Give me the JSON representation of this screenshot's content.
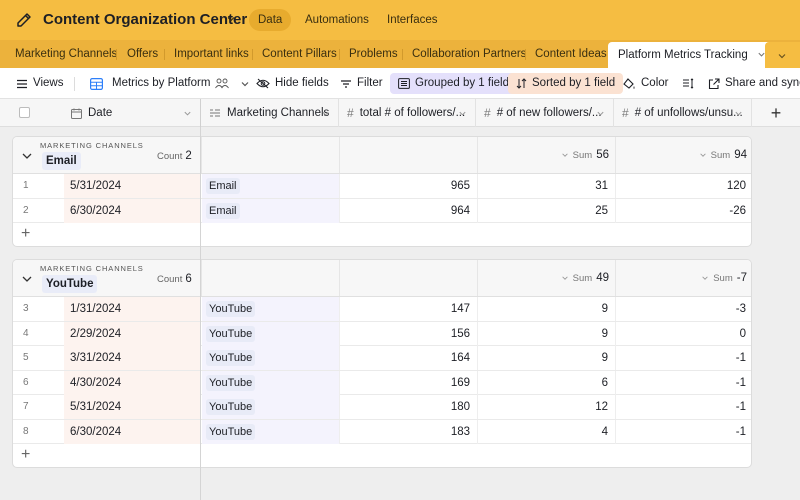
{
  "app": {
    "title": "Content Organization Center",
    "nav": [
      {
        "label": "Data",
        "active": true
      },
      {
        "label": "Automations",
        "active": false
      },
      {
        "label": "Interfaces",
        "active": false
      }
    ],
    "brand_color": "#f5bd42"
  },
  "tabs": [
    {
      "label": "Marketing Channels"
    },
    {
      "label": "Offers"
    },
    {
      "label": "Important links"
    },
    {
      "label": "Content Pillars"
    },
    {
      "label": "Problems"
    },
    {
      "label": "Collaboration Partners"
    },
    {
      "label": "Content Ideas"
    },
    {
      "label": "Platform Metrics Tracking",
      "active": true
    }
  ],
  "toolbar": {
    "views": "Views",
    "view_name": "Metrics by Platform",
    "hide_fields": "Hide fields",
    "filter": "Filter",
    "grouped": "Grouped by 1 field",
    "sorted": "Sorted by 1 field",
    "color": "Color",
    "share": "Share and sync"
  },
  "columns": [
    {
      "label": "Date",
      "icon": "calendar-icon"
    },
    {
      "label": "Marketing Channels",
      "icon": "link-field-icon"
    },
    {
      "label": "total # of followers/...",
      "icon": "number-icon"
    },
    {
      "label": "# of new followers/...",
      "icon": "number-icon"
    },
    {
      "label": "# of unfollows/unsu...",
      "icon": "number-icon"
    }
  ],
  "groups": [
    {
      "label": "MARKETING CHANNELS",
      "name": "Email",
      "count_label": "Count",
      "count": "2",
      "sum_label": "Sum",
      "sum_new": "56",
      "sum_unf": "94",
      "rows": [
        {
          "num": "1",
          "date": "5/31/2024",
          "channel": "Email",
          "total": "965",
          "new": "31",
          "unf": "120"
        },
        {
          "num": "2",
          "date": "6/30/2024",
          "channel": "Email",
          "total": "964",
          "new": "25",
          "unf": "-26"
        }
      ]
    },
    {
      "label": "MARKETING CHANNELS",
      "name": "YouTube",
      "count_label": "Count",
      "count": "6",
      "sum_label": "Sum",
      "sum_new": "49",
      "sum_unf": "-7",
      "rows": [
        {
          "num": "3",
          "date": "1/31/2024",
          "channel": "YouTube",
          "total": "147",
          "new": "9",
          "unf": "-3"
        },
        {
          "num": "4",
          "date": "2/29/2024",
          "channel": "YouTube",
          "total": "156",
          "new": "9",
          "unf": "0"
        },
        {
          "num": "5",
          "date": "3/31/2024",
          "channel": "YouTube",
          "total": "164",
          "new": "9",
          "unf": "-1"
        },
        {
          "num": "6",
          "date": "4/30/2024",
          "channel": "YouTube",
          "total": "169",
          "new": "6",
          "unf": "-1"
        },
        {
          "num": "7",
          "date": "5/31/2024",
          "channel": "YouTube",
          "total": "180",
          "new": "12",
          "unf": "-1"
        },
        {
          "num": "8",
          "date": "6/30/2024",
          "channel": "YouTube",
          "total": "183",
          "new": "4",
          "unf": "-1"
        }
      ]
    }
  ]
}
